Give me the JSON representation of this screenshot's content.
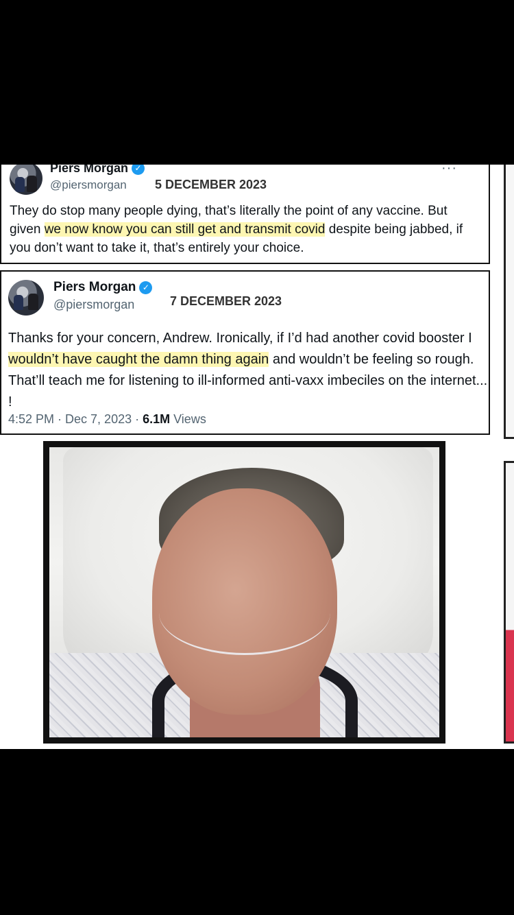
{
  "tweet1": {
    "name": "Piers Morgan",
    "handle": "@piersmorgan",
    "date": "5 DECEMBER 2023",
    "more": "···",
    "text_before": "They do stop many people dying, that’s literally the point of any vaccine. But given ",
    "text_highlight": "we now know you can still get and transmit covid",
    "text_after": " despite being jabbed, if you don’t want to take it, that’s entirely your choice."
  },
  "tweet2": {
    "name": "Piers Morgan",
    "handle": "@piersmorgan",
    "date": "7 DECEMBER 2023",
    "text_before": "Thanks for your concern, Andrew. Ironically, if I’d had another covid booster I ",
    "text_highlight": "wouldn’t have caught the damn thing again",
    "text_after": " and wouldn’t be feeling so rough. That’ll teach me for listening to ill-informed anti-vaxx imbeciles on the internet... !",
    "time": "4:52 PM · Dec 7, 2023 · ",
    "views_count": "6.1M",
    "views_label": " Views"
  },
  "icons": {
    "verified": "verified-badge-icon",
    "more": "more-options-icon"
  },
  "colors": {
    "highlight": "#fdf6b2",
    "verified": "#1d9bf0",
    "accent_red": "#d9344f"
  }
}
